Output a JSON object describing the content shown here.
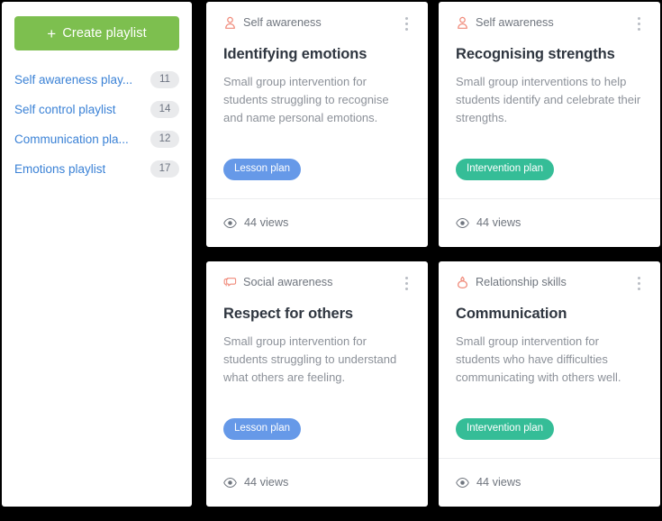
{
  "sidebar": {
    "create_button": {
      "label": "Create playlist",
      "icon": "plus-icon",
      "color": "#7dbf4f"
    },
    "playlists": [
      {
        "name": "Self awareness play...",
        "count": "11"
      },
      {
        "name": "Self control playlist",
        "count": "14"
      },
      {
        "name": "Communication pla...",
        "count": "12"
      },
      {
        "name": "Emotions playlist",
        "count": "17"
      }
    ],
    "link_color": "#3b82d6",
    "badge_color": "#e9eaec"
  },
  "cards": [
    {
      "category": "Self awareness",
      "category_icon": "person-icon",
      "title": "Identifying emotions",
      "description": "Small group intervention for students struggling to recognise and name personal emotions.",
      "tag": "Lesson plan",
      "tag_type": "lesson",
      "tag_color": "#6699e8",
      "views": "44 views",
      "views_icon": "eye-icon",
      "menu_icon": "kebab-menu-icon"
    },
    {
      "category": "Self awareness",
      "category_icon": "person-icon",
      "title": "Recognising strengths",
      "description": "Small group interventions to help students identify and celebrate their strengths.",
      "tag": "Intervention plan",
      "tag_type": "intervention",
      "tag_color": "#35bd97",
      "views": "44 views",
      "views_icon": "eye-icon",
      "menu_icon": "kebab-menu-icon"
    },
    {
      "category": "Social awareness",
      "category_icon": "speech-bubbles-icon",
      "title": "Respect for others",
      "description": "Small group intervention for students struggling to understand what others are feeling.",
      "tag": "Lesson plan",
      "tag_type": "lesson",
      "tag_color": "#6699e8",
      "views": "44 views",
      "views_icon": "eye-icon",
      "menu_icon": "kebab-menu-icon"
    },
    {
      "category": "Relationship skills",
      "category_icon": "handshake-icon",
      "title": "Communication",
      "description": "Small group intervention for students who have difficulties communicating with others well.",
      "tag": "Intervention plan",
      "tag_type": "intervention",
      "tag_color": "#35bd97",
      "views": "44 views",
      "views_icon": "eye-icon",
      "menu_icon": "kebab-menu-icon"
    }
  ],
  "theme": {
    "category_icon_color": "#f08a7a",
    "background": "#000000",
    "panel": "#ffffff"
  }
}
